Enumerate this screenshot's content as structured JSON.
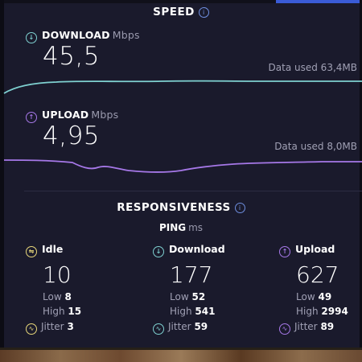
{
  "speed": {
    "title": "SPEED",
    "download": {
      "label": "DOWNLOAD",
      "unit": "Mbps",
      "value": "45,5",
      "data_used": "Data used 63,4MB",
      "color": "#7fd1d1"
    },
    "upload": {
      "label": "UPLOAD",
      "unit": "Mbps",
      "value": "4,95",
      "data_used": "Data used 8,0MB",
      "color": "#a678e8"
    }
  },
  "responsiveness": {
    "title": "RESPONSIVENESS",
    "ping_label": "PING",
    "ping_unit": "ms",
    "low_label": "Low",
    "high_label": "High",
    "jitter_label": "Jitter",
    "idle": {
      "label": "Idle",
      "value": "10",
      "low": "8",
      "high": "15",
      "jitter": "3",
      "color": "#e8d77a"
    },
    "download": {
      "label": "Download",
      "value": "177",
      "low": "52",
      "high": "541",
      "jitter": "59",
      "color": "#7fd1d1"
    },
    "upload": {
      "label": "Upload",
      "value": "627",
      "low": "49",
      "high": "2994",
      "jitter": "89",
      "color": "#a678e8"
    }
  }
}
